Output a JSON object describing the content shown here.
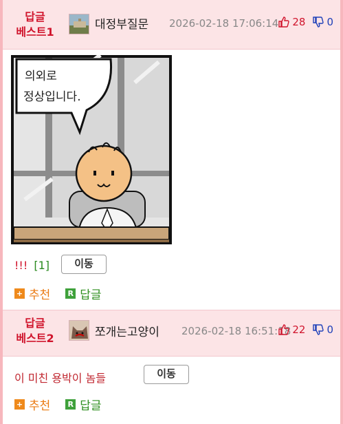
{
  "replies": [
    {
      "badge_line1": "답글",
      "badge_line2": "베스트1",
      "nickname": "대정부질문",
      "timestamp": "2026-02-18 17:06:14",
      "upvotes": "28",
      "downvotes": "0",
      "comic_text_line1": "의외로",
      "comic_text_line2": "정상입니다.",
      "body_exclaim": "!!!",
      "body_ref": "[1]",
      "move_label": "이동",
      "recommend_label": "추천",
      "reply_label": "답글"
    },
    {
      "badge_line1": "답글",
      "badge_line2": "베스트2",
      "nickname": "쪼개는고양이",
      "timestamp": "2026-02-18 16:51:18",
      "upvotes": "22",
      "downvotes": "0",
      "body_text": "이 미친 용박이 놈들",
      "move_label": "이동",
      "recommend_label": "추천",
      "reply_label": "답글"
    }
  ],
  "icons": {
    "upvote": "thumbs-up-icon",
    "downvote": "thumbs-down-icon",
    "recommend": "plus-square-icon",
    "reply": "r-square-icon"
  },
  "colors": {
    "accent_red": "#d0142c",
    "header_bg": "#fce4e6",
    "down_blue": "#1d3fb8",
    "recommend_orange": "#ea7a12",
    "reply_green": "#2f8f1f"
  }
}
